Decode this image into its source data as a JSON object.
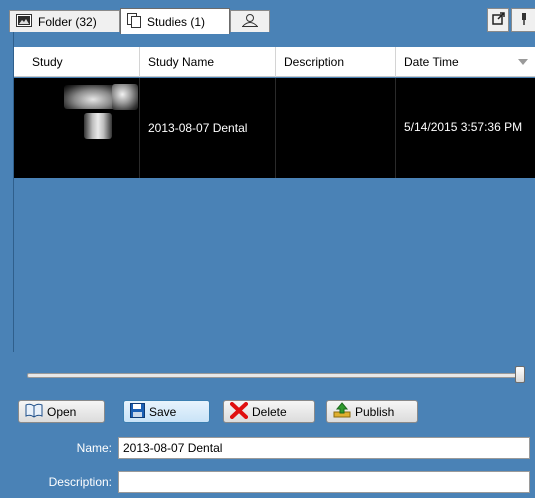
{
  "tabs": {
    "folder_label": "Folder (32)",
    "studies_label": "Studies (1)"
  },
  "grid": {
    "columns": [
      "Study",
      "Study Name",
      "Description",
      "Date Time"
    ],
    "rows": [
      {
        "study_name": "2013-08-07 Dental",
        "description": "",
        "date_time": "5/14/2015 3:57:36 PM"
      }
    ]
  },
  "zoom_slider": {
    "value": 1.0
  },
  "actions": {
    "open": "Open",
    "save": "Save",
    "delete": "Delete",
    "publish": "Publish"
  },
  "form": {
    "name_label": "Name:",
    "name_value": "2013-08-07 Dental",
    "description_label": "Description:",
    "description_value": ""
  },
  "colors": {
    "panel_bg": "#4a82b6",
    "selected_row": "#000000",
    "delete_icon": "#e01010",
    "save_icon": "#1a5fb4",
    "publish_icon": "#2e9a2e"
  }
}
